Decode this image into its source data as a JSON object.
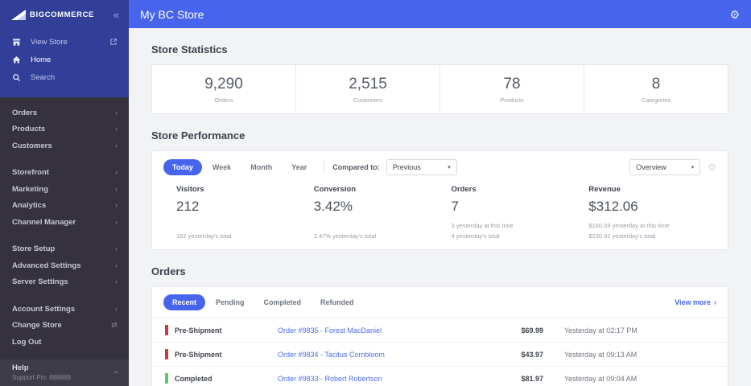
{
  "colors": {
    "accent_blue": "#4765ec",
    "sidebar_blue": "#323f98",
    "sidebar_dark": "#35323d",
    "link_blue": "#4f6cf1",
    "status_red": "#c8373e",
    "status_green": "#62c462"
  },
  "icons": {
    "collapse": "«",
    "chevron": "›",
    "caret_down": "▾",
    "gear": "⚙"
  },
  "sidebar": {
    "logo_text": "BIGCOMMERCE",
    "view_store_label": "View Store",
    "home_label": "Home",
    "search_label": "Search",
    "menu_groups": [
      [
        {
          "label": "Orders",
          "right_icon": "›"
        },
        {
          "label": "Products",
          "right_icon": "›"
        },
        {
          "label": "Customers",
          "right_icon": "›"
        }
      ],
      [
        {
          "label": "Storefront",
          "right_icon": "›"
        },
        {
          "label": "Marketing",
          "right_icon": "›"
        },
        {
          "label": "Analytics",
          "right_icon": "›"
        },
        {
          "label": "Channel Manager",
          "right_icon": "›"
        }
      ],
      [
        {
          "label": "Store Setup",
          "right_icon": "›"
        },
        {
          "label": "Advanced Settings",
          "right_icon": "›"
        },
        {
          "label": "Server Settings",
          "right_icon": "›"
        }
      ],
      [
        {
          "label": "Account Settings",
          "right_icon": "›"
        },
        {
          "label": "Change Store",
          "right_icon": "⇄"
        },
        {
          "label": "Log Out",
          "right_icon": ""
        }
      ]
    ],
    "help": {
      "title": "Help",
      "subtitle": "Support Pin: 888888"
    }
  },
  "header": {
    "title": "My BC Store"
  },
  "store_statistics": {
    "title": "Store Statistics",
    "stats": [
      {
        "value": "9,290",
        "label": "Orders"
      },
      {
        "value": "2,515",
        "label": "Customers"
      },
      {
        "value": "78",
        "label": "Products"
      },
      {
        "value": "8",
        "label": "Categories"
      }
    ]
  },
  "store_performance": {
    "title": "Store Performance",
    "tabs": [
      "Today",
      "Week",
      "Month",
      "Year"
    ],
    "active_tab": "Today",
    "compared_to_label": "Compared to:",
    "compared_to_value": "Previous",
    "view_select_value": "Overview",
    "metrics": [
      {
        "label": "Visitors",
        "value": "212",
        "sub_lines": [
          "162 yesterday's total"
        ]
      },
      {
        "label": "Conversion",
        "value": "3.42%",
        "sub_lines": [
          "2.47% yesterday's total"
        ]
      },
      {
        "label": "Orders",
        "value": "7",
        "sub_lines": [
          "3 yesterday at this time",
          "4 yesterday's total"
        ]
      },
      {
        "label": "Revenue",
        "value": "$312.06",
        "sub_lines": [
          "$160.59 yesterday at this time",
          "$230.92 yesterday's total"
        ]
      }
    ]
  },
  "orders": {
    "title": "Orders",
    "tabs": [
      "Recent",
      "Pending",
      "Completed",
      "Refunded"
    ],
    "active_tab": "Recent",
    "view_more_label": "View more",
    "rows": [
      {
        "status": "Pre-Shipment",
        "status_color": "#c8373e",
        "link": "Order #9835 - Forest MacDaniel",
        "amount": "$69.99",
        "time": "Yesterday at 02:17 PM"
      },
      {
        "status": "Pre-Shipment",
        "status_color": "#c8373e",
        "link": "Order #9834 - Tacitus Cornbloom",
        "amount": "$43.97",
        "time": "Yesterday at 09:13 AM"
      },
      {
        "status": "Completed",
        "status_color": "#62c462",
        "link": "Order #9833 - Robert Robertson",
        "amount": "$81.97",
        "time": "Yesterday at 09:04 AM"
      }
    ]
  }
}
